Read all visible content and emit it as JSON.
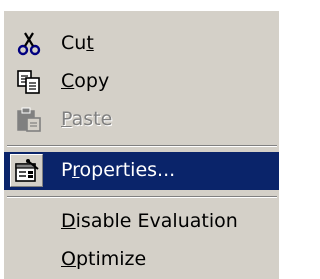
{
  "menu": {
    "items": [
      {
        "before": "Cu",
        "accel": "t",
        "after": "",
        "icon": "scissors-icon",
        "state": "enabled"
      },
      {
        "before": "",
        "accel": "C",
        "after": "opy",
        "icon": "copy-icon",
        "state": "enabled"
      },
      {
        "before": "",
        "accel": "P",
        "after": "aste",
        "icon": "paste-icon",
        "state": "disabled"
      },
      {
        "before": "P",
        "accel": "r",
        "after": "operties...",
        "icon": "properties-icon",
        "state": "highlighted"
      },
      {
        "before": "",
        "accel": "D",
        "after": "isable Evaluation",
        "icon": "",
        "state": "enabled"
      },
      {
        "before": "",
        "accel": "O",
        "after": "ptimize",
        "icon": "",
        "state": "enabled"
      }
    ]
  },
  "colors": {
    "menu_background": "#d4d0c8",
    "highlight_background": "#0a246a",
    "highlight_text": "#ffffff",
    "disabled_text": "#808080"
  }
}
